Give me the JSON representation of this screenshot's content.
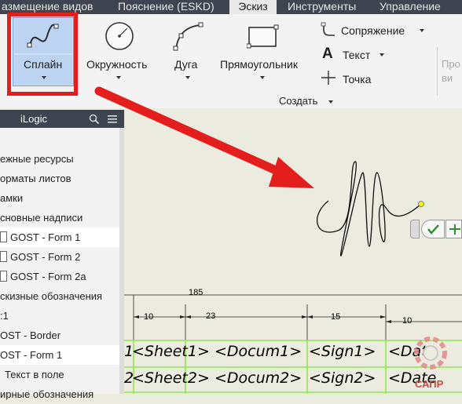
{
  "ribbon_tabs": [
    {
      "label": "азмещение видов",
      "active": false
    },
    {
      "label": "Пояснение (ESKD)",
      "active": false
    },
    {
      "label": "Эскиз",
      "active": true
    },
    {
      "label": "Инструменты",
      "active": false
    },
    {
      "label": "Управление",
      "active": false
    }
  ],
  "ribbon": {
    "spline_label": "Сплайн",
    "circle_label": "Окружность",
    "arc_label": "Дуга",
    "rect_label": "Прямоугольник",
    "fillet_label": "Сопряжение",
    "text_label": "Текст",
    "point_label": "Точка",
    "create_group_label": "Создать",
    "cut_label_1": "Про",
    "cut_label_2": "ви"
  },
  "sidebar": {
    "title": "iLogic",
    "items": [
      {
        "label": "ежные ресурсы",
        "icon": "",
        "selected": false
      },
      {
        "label": "орматы листов",
        "icon": "",
        "selected": false
      },
      {
        "label": "амки",
        "icon": "",
        "selected": false
      },
      {
        "label": "сновные надписи",
        "icon": "",
        "selected": false
      },
      {
        "label": "GOST - Form 1",
        "icon": "document-icon",
        "selected": true
      },
      {
        "label": "GOST - Form 2",
        "icon": "document-icon",
        "selected": false
      },
      {
        "label": "GOST - Form 2a",
        "icon": "document-icon",
        "selected": false
      },
      {
        "label": "скизные обозначения",
        "icon": "",
        "selected": false
      },
      {
        "label": ":1",
        "icon": "",
        "selected": false
      },
      {
        "label": "OST - Border",
        "icon": "",
        "selected": false
      },
      {
        "label": "OST - Form 1",
        "icon": "",
        "selected": true
      },
      {
        "label": "Текст в поле",
        "icon": "",
        "selected": false
      },
      {
        "label": "ирные обозначения",
        "icon": "",
        "selected": false
      }
    ]
  },
  "drawing": {
    "dim_total": "185",
    "dim_a": "10",
    "dim_b": "23",
    "dim_c": "15",
    "dim_d": "10",
    "row1": [
      "1",
      "<Sheet1>",
      "<Docum1>",
      "<Sign1>",
      "<Date"
    ],
    "row2": [
      "2",
      "<Sheet2>",
      "<Docum2>",
      "<Sign2>",
      "<Date"
    ]
  },
  "watermark": "САПР",
  "colors": {
    "highlight": "#e41d1d",
    "spline": "#111111",
    "endpoint": "#f2f20a",
    "title_grid": "#8fe84a",
    "accept": "#2f8f2f"
  }
}
